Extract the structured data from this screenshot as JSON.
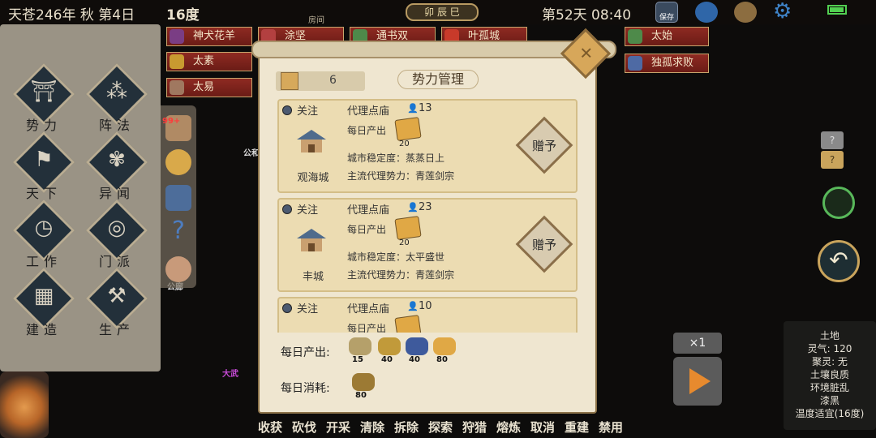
{
  "topbar": {
    "date": "天苍246年 秋 第4日",
    "temperature": "16度",
    "shichen": "卯 辰 巳",
    "room": "房间",
    "daytime": "第52天 08:40",
    "save_label": "保存"
  },
  "map_labels": [
    "公和",
    "公廊",
    "大武"
  ],
  "left_menu": [
    {
      "label": "势力",
      "icon": "faction-icon"
    },
    {
      "label": "阵法",
      "icon": "formation-icon"
    },
    {
      "label": "天下",
      "icon": "world-icon"
    },
    {
      "label": "异闻",
      "icon": "rumor-icon"
    },
    {
      "label": "工作",
      "icon": "work-icon"
    },
    {
      "label": "门派",
      "icon": "sect-icon"
    },
    {
      "label": "建造",
      "icon": "build-icon"
    },
    {
      "label": "生产",
      "icon": "produce-icon"
    }
  ],
  "side_strip": {
    "badge": "99+"
  },
  "name_tags": [
    "神犬花羊",
    "涂坚",
    "通书双",
    "叶孤城",
    "太始",
    "太素",
    "独孤求败",
    "太易"
  ],
  "dialog": {
    "count": "6",
    "title": "势力管理",
    "cards": [
      {
        "follow": "关注",
        "city": "观海城",
        "agent_label": "代理点庙",
        "agent_count": "13",
        "daily_label": "每日产出",
        "reward": "20",
        "stability": "城市稳定度：蒸蒸日上",
        "main_power": "主流代理势力：青莲剑宗",
        "gift": "赠予"
      },
      {
        "follow": "关注",
        "city": "丰城",
        "agent_label": "代理点庙",
        "agent_count": "23",
        "daily_label": "每日产出",
        "reward": "20",
        "stability": "城市稳定度：太平盛世",
        "main_power": "主流代理势力：青莲剑宗",
        "gift": "赠予"
      },
      {
        "follow": "关注",
        "city": "",
        "agent_label": "代理点庙",
        "agent_count": "10",
        "daily_label": "每日产出",
        "reward": "",
        "stability": "",
        "main_power": "",
        "gift": ""
      }
    ],
    "production_label": "每日产出:",
    "production": [
      {
        "icon": "ore-icon",
        "value": "15",
        "color": "#b5a06a"
      },
      {
        "icon": "gold-pile-icon",
        "value": "40",
        "color": "#c19a3a"
      },
      {
        "icon": "blue-stone-icon",
        "value": "40",
        "color": "#3e5a9c"
      },
      {
        "icon": "gold-ticket-icon",
        "value": "80",
        "color": "#e0a845"
      }
    ],
    "consumption_label": "每日消耗:",
    "consumption": [
      {
        "icon": "grain-sack-icon",
        "value": "80",
        "color": "#9c7a34"
      }
    ]
  },
  "actions": [
    "收获",
    "砍伐",
    "开采",
    "清除",
    "拆除",
    "探索",
    "狩猎",
    "熔炼",
    "取消",
    "重建",
    "禁用"
  ],
  "speed": "×1",
  "info_panel": [
    "土地",
    "灵气: 120",
    "聚灵: 无",
    "土壤良质",
    "环境脏乱",
    "漆黑",
    "温度适宜(16度)"
  ],
  "help": {
    "a": "?",
    "b": "?"
  }
}
